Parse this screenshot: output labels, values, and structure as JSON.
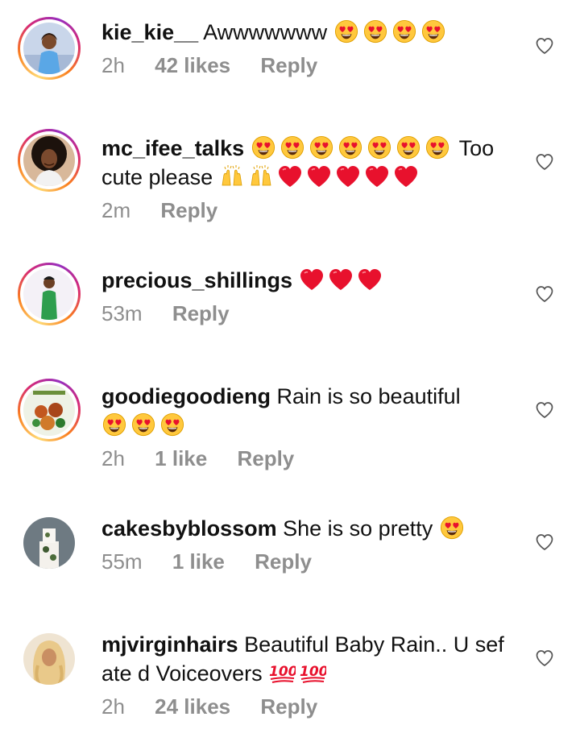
{
  "comments": [
    {
      "username": "kie_kie__",
      "text": "Awwwwwww",
      "emoji": [
        "😍",
        "😍",
        "😍",
        "😍"
      ],
      "time": "2h",
      "likes": "42 likes",
      "reply": "Reply",
      "text2": "",
      "emoji2": []
    },
    {
      "username": "mc_ifee_talks",
      "text": "",
      "emoji": [
        "😍",
        "😍",
        "😍",
        "😍",
        "😍",
        "😍",
        "😍"
      ],
      "text_after": "Too",
      "text2": "cute please",
      "emoji2": [
        "🙌",
        "🙌",
        "❤️",
        "❤️",
        "❤️",
        "❤️",
        "❤️"
      ],
      "time": "2m",
      "likes": "",
      "reply": "Reply"
    },
    {
      "username": "precious_shillings",
      "text": "",
      "emoji": [
        "❤️",
        "❤️",
        "❤️"
      ],
      "time": "53m",
      "likes": "",
      "reply": "Reply",
      "text2": "",
      "emoji2": []
    },
    {
      "username": "goodiegoodieng",
      "text": "Rain is so beautiful",
      "emoji": [],
      "text2": "",
      "emoji2": [
        "😍",
        "😍",
        "😍"
      ],
      "time": "2h",
      "likes": "1 like",
      "reply": "Reply"
    },
    {
      "username": "cakesbyblossom",
      "text": "She is so pretty",
      "emoji": [
        "😍"
      ],
      "time": "55m",
      "likes": "1 like",
      "reply": "Reply",
      "text2": "",
      "emoji2": []
    },
    {
      "username": "mjvirginhairs",
      "text": "Beautiful Baby Rain.. U sef",
      "emoji": [],
      "text2": "ate d Voiceovers",
      "emoji2": [
        "💯",
        "💯"
      ],
      "time": "2h",
      "likes": "24 likes",
      "reply": "Reply"
    }
  ],
  "icons": {
    "like": "heart-outline-icon"
  },
  "colors": {
    "meta": "#8e8e8e",
    "text": "#111111",
    "ring_start": "#feda75",
    "ring_end": "#962fbf",
    "heart_emoji": "#e8112d",
    "face_emoji": "#ffc83d"
  }
}
